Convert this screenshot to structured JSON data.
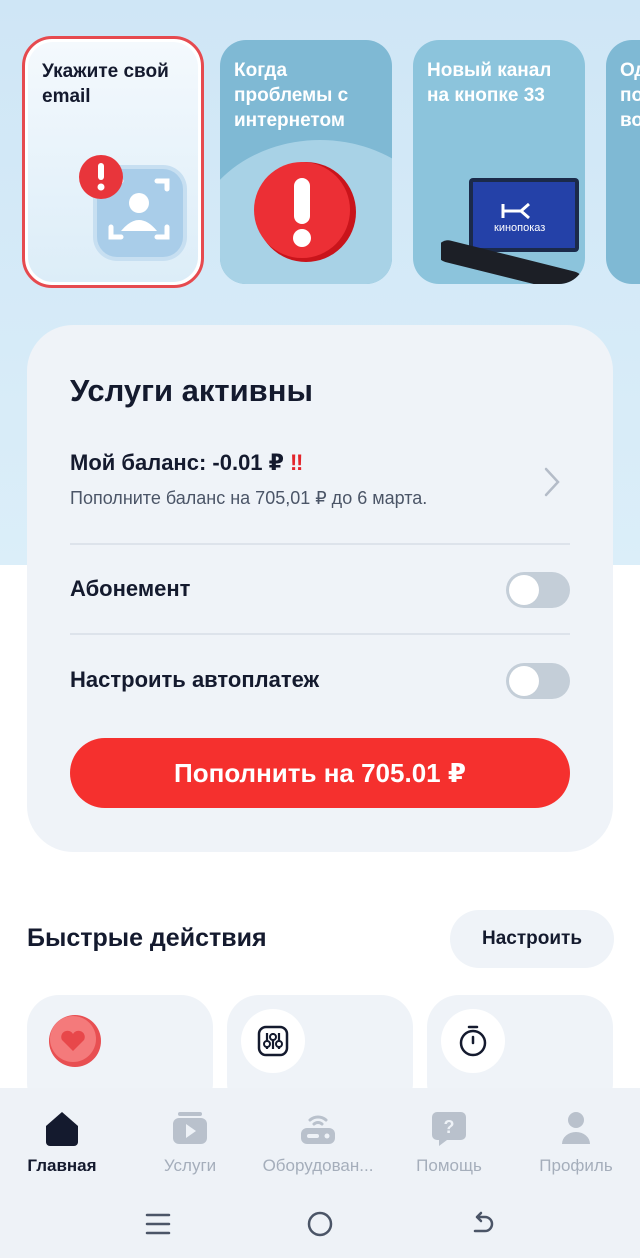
{
  "stories": [
    {
      "title": "Укажите свой email"
    },
    {
      "title": "Когда проблемы с интернетом"
    },
    {
      "title": "Новый канал на кнопке 33",
      "tv_label": "кинопоказ"
    },
    {
      "title": "Од по во"
    }
  ],
  "services": {
    "title": "Услуги активны",
    "balance_label": "Мой баланс: -0.01 ₽",
    "balance_warn": "‼",
    "balance_hint": "Пополните баланс на 705,01 ₽ до 6 марта.",
    "subscription_label": "Абонемент",
    "autopay_label": "Настроить автоплатеж",
    "pay_button": "Пополнить на 705.01 ₽"
  },
  "quick_actions": {
    "title": "Быстрые действия",
    "config_button": "Настроить"
  },
  "bottom_nav": {
    "items": [
      {
        "label": "Главная",
        "icon": "home-icon",
        "active": true
      },
      {
        "label": "Услуги",
        "icon": "services-icon",
        "active": false
      },
      {
        "label": "Оборудован...",
        "icon": "router-icon",
        "active": false
      },
      {
        "label": "Помощь",
        "icon": "help-icon",
        "active": false
      },
      {
        "label": "Профиль",
        "icon": "profile-icon",
        "active": false
      }
    ]
  },
  "colors": {
    "accent_red": "#f5302e",
    "text_dark": "#141a2e",
    "card_bg": "#eff3f8"
  }
}
